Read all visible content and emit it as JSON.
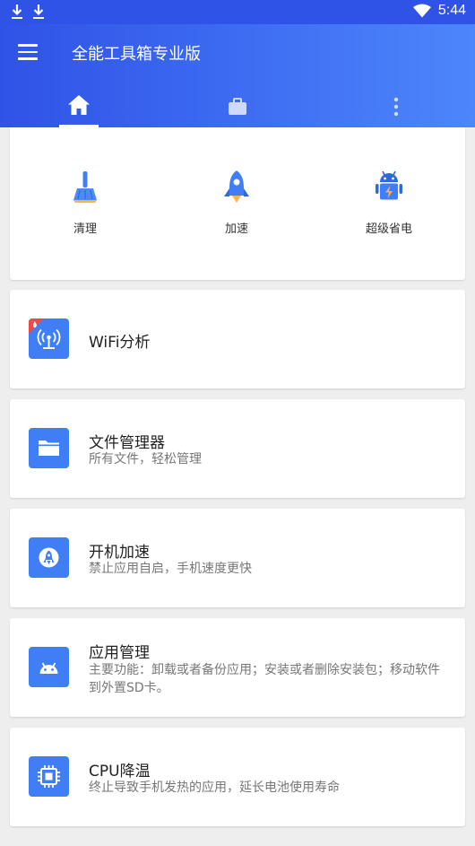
{
  "status_bar": {
    "time": "5:44"
  },
  "app": {
    "title": "全能工具箱专业版"
  },
  "tabs": [
    "home",
    "tools",
    "more"
  ],
  "quick_actions": [
    {
      "label": "清理",
      "icon": "broom-icon"
    },
    {
      "label": "加速",
      "icon": "rocket-icon"
    },
    {
      "label": "超级省电",
      "icon": "android-battery-icon"
    }
  ],
  "list": [
    {
      "title": "WiFi分析",
      "subtitle": "",
      "icon": "wifi-antenna-icon",
      "badge": "hot"
    },
    {
      "title": "文件管理器",
      "subtitle": "所有文件，轻松管理",
      "icon": "folder-icon"
    },
    {
      "title": "开机加速",
      "subtitle": "禁止应用自启，手机速度更快",
      "icon": "rocket-icon"
    },
    {
      "title": "应用管理",
      "subtitle": "主要功能：卸载或者备份应用；安装或者删除安装包；移动软件到外置SD卡。",
      "icon": "android-icon"
    },
    {
      "title": "CPU降温",
      "subtitle": "终止导致手机发热的应用，延长电池使用寿命",
      "icon": "cpu-icon"
    }
  ],
  "colors": {
    "primary": "#2f53e6",
    "accent": "#3f7ef4",
    "badge": "#e94a4a"
  }
}
